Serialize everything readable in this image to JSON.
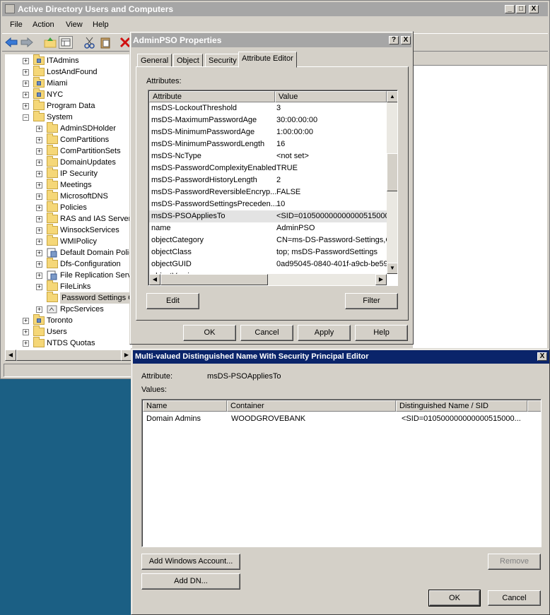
{
  "main_window": {
    "title": "Active Directory Users and Computers",
    "min": "_",
    "max": "□",
    "close": "X"
  },
  "menu": [
    "File",
    "Action",
    "View",
    "Help"
  ],
  "tree": [
    {
      "label": "ITAdmins",
      "level": 1,
      "exp": "+",
      "icon": "ou"
    },
    {
      "label": "LostAndFound",
      "level": 1,
      "exp": "+",
      "icon": "folder"
    },
    {
      "label": "Miami",
      "level": 1,
      "exp": "+",
      "icon": "ou"
    },
    {
      "label": "NYC",
      "level": 1,
      "exp": "+",
      "icon": "ou"
    },
    {
      "label": "Program Data",
      "level": 1,
      "exp": "+",
      "icon": "folder"
    },
    {
      "label": "System",
      "level": 1,
      "exp": "−",
      "icon": "folder"
    },
    {
      "label": "AdminSDHolder",
      "level": 2,
      "exp": "+",
      "icon": "folder"
    },
    {
      "label": "ComPartitions",
      "level": 2,
      "exp": "+",
      "icon": "folder"
    },
    {
      "label": "ComPartitionSets",
      "level": 2,
      "exp": "+",
      "icon": "folder"
    },
    {
      "label": "DomainUpdates",
      "level": 2,
      "exp": "+",
      "icon": "folder"
    },
    {
      "label": "IP Security",
      "level": 2,
      "exp": "+",
      "icon": "folder"
    },
    {
      "label": "Meetings",
      "level": 2,
      "exp": "+",
      "icon": "folder"
    },
    {
      "label": "MicrosoftDNS",
      "level": 2,
      "exp": "+",
      "icon": "folder"
    },
    {
      "label": "Policies",
      "level": 2,
      "exp": "+",
      "icon": "folder"
    },
    {
      "label": "RAS and IAS Server",
      "level": 2,
      "exp": "+",
      "icon": "folder"
    },
    {
      "label": "WinsockServices",
      "level": 2,
      "exp": "+",
      "icon": "folder"
    },
    {
      "label": "WMIPolicy",
      "level": 2,
      "exp": "+",
      "icon": "folder"
    },
    {
      "label": "Default Domain Polic",
      "level": 2,
      "exp": "+",
      "icon": "policy"
    },
    {
      "label": "Dfs-Configuration",
      "level": 2,
      "exp": "+",
      "icon": "folder"
    },
    {
      "label": "File Replication Serv",
      "level": 2,
      "exp": "+",
      "icon": "policy"
    },
    {
      "label": "FileLinks",
      "level": 2,
      "exp": "+",
      "icon": "folder"
    },
    {
      "label": "Password Settings C",
      "level": 2,
      "exp": "",
      "icon": "folder",
      "selected": true
    },
    {
      "label": "RpcServices",
      "level": 2,
      "exp": "+",
      "icon": "rpc"
    },
    {
      "label": "Toronto",
      "level": 1,
      "exp": "+",
      "icon": "ou"
    },
    {
      "label": "Users",
      "level": 1,
      "exp": "+",
      "icon": "folder"
    },
    {
      "label": "NTDS Quotas",
      "level": 1,
      "exp": "+",
      "icon": "folder"
    }
  ],
  "props": {
    "title": "AdminPSO Properties",
    "help": "?",
    "close": "X",
    "tabs": [
      "General",
      "Object",
      "Security",
      "Attribute Editor"
    ],
    "attributes_label": "Attributes:",
    "col_attribute": "Attribute",
    "col_value": "Value",
    "rows": [
      {
        "n": "msDS-LockoutThreshold",
        "v": "3"
      },
      {
        "n": "msDS-MaximumPasswordAge",
        "v": "30:00:00:00"
      },
      {
        "n": "msDS-MinimumPasswordAge",
        "v": "1:00:00:00"
      },
      {
        "n": "msDS-MinimumPasswordLength",
        "v": "16"
      },
      {
        "n": "msDS-NcType",
        "v": "<not set>"
      },
      {
        "n": "msDS-PasswordComplexityEnabled",
        "v": "TRUE"
      },
      {
        "n": "msDS-PasswordHistoryLength",
        "v": "2"
      },
      {
        "n": "msDS-PasswordReversibleEncryp...",
        "v": "FALSE"
      },
      {
        "n": "msDS-PasswordSettingsPreceden...",
        "v": "10"
      },
      {
        "n": "msDS-PSOAppliesTo",
        "v": "<SID=01050000000000051500000"
      },
      {
        "n": "name",
        "v": "AdminPSO"
      },
      {
        "n": "objectCategory",
        "v": "CN=ms-DS-Password-Settings,C"
      },
      {
        "n": "objectClass",
        "v": "top; msDS-PasswordSettings"
      },
      {
        "n": "objectGUID",
        "v": "0ad95045-0840-401f-a9cb-be59"
      },
      {
        "n": "objectVersion",
        "v": ""
      }
    ],
    "edit": "Edit",
    "filter": "Filter",
    "ok": "OK",
    "cancel": "Cancel",
    "apply": "Apply",
    "help_btn": "Help"
  },
  "mv": {
    "title": "Multi-valued Distinguished Name With Security Principal Editor",
    "close": "X",
    "attribute_label": "Attribute:",
    "attribute_value": "msDS-PSOAppliesTo",
    "values_label": "Values:",
    "col_name": "Name",
    "col_container": "Container",
    "col_dn": "Distinguished Name / SID",
    "rows": [
      {
        "name": "Domain Admins",
        "container": "WOODGROVEBANK",
        "dn": "<SID=010500000000000515000..."
      }
    ],
    "add_windows": "Add Windows Account...",
    "add_dn": "Add DN...",
    "remove": "Remove",
    "ok": "OK",
    "cancel": "Cancel"
  },
  "colors": {
    "desktop": "#1b5f84",
    "active_title": "#0a246a",
    "inactive_title": "#a6a6a6",
    "face": "#d4d0c8"
  }
}
